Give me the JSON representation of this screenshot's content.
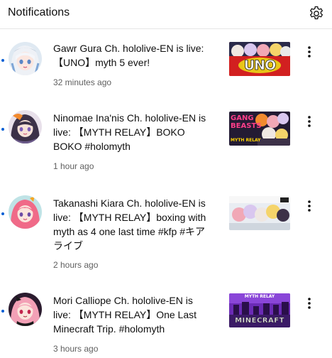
{
  "header": {
    "title": "Notifications",
    "settings_icon": "gear-icon"
  },
  "notifications": [
    {
      "text": "Gawr Gura Ch. hololive-EN is live: 【UNO】myth 5 ever!",
      "time": "32 minutes ago",
      "thumb_label": "UNO",
      "unread": true
    },
    {
      "text": "Ninomae Ina'nis Ch. hololive-EN is live: 【MYTH RELAY】BOKO BOKO #holomyth",
      "time": "1 hour ago",
      "thumb_label": "GANG BEASTS",
      "thumb_sub": "MYTH RELAY",
      "unread": true
    },
    {
      "text": "Takanashi Kiara Ch. hololive-EN is live: 【MYTH RELAY】boxing with myth as 4 one last time #kfp #キアライブ",
      "time": "2 hours ago",
      "unread": true
    },
    {
      "text": "Mori Calliope Ch. hololive-EN is live: 【MYTH RELAY】One Last Minecraft Trip. #holomyth",
      "time": "3 hours ago",
      "thumb_label": "MINECRAFT",
      "thumb_sub": "MYTH RELAY",
      "unread": true
    }
  ],
  "colors": {
    "unread_dot": "#065fd4",
    "secondary_text": "#606060",
    "divider": "#e5e5e5"
  }
}
